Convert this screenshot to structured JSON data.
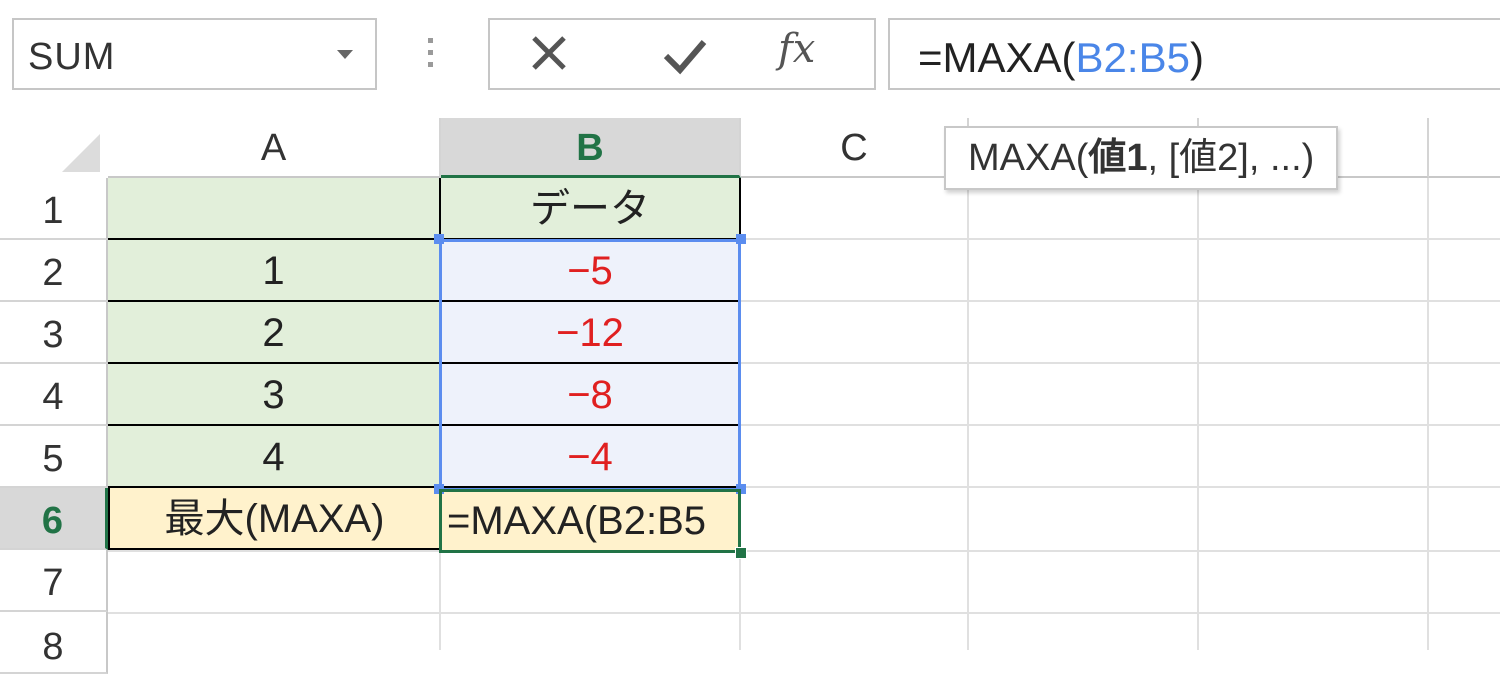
{
  "formula_bar": {
    "name_box": "SUM",
    "cancel_icon": "close-icon",
    "enter_icon": "check-icon",
    "function_label": "fx",
    "formula_prefix": "=MAXA(",
    "formula_ref": "B2:B5",
    "formula_suffix": ")"
  },
  "tooltip": {
    "prefix": "MAXA(",
    "arg1": "値1",
    "rest": ", [値2], ...)"
  },
  "columns": [
    "A",
    "B",
    "C"
  ],
  "rows": [
    "1",
    "2",
    "3",
    "4",
    "5",
    "6",
    "7",
    "8"
  ],
  "cells": {
    "B1": "データ",
    "A2": "1",
    "B2": "−5",
    "A3": "2",
    "B3": "−12",
    "A4": "3",
    "B4": "−8",
    "A5": "4",
    "B5": "−4",
    "A6": "最大(MAXA)",
    "B6": "=MAXA(B2:B5"
  },
  "colors": {
    "selected_header": "#217346",
    "range_highlight": "#5b8def",
    "negative_text": "#e02020",
    "label_fill": "#e2efda",
    "result_fill": "#fff2cc"
  }
}
